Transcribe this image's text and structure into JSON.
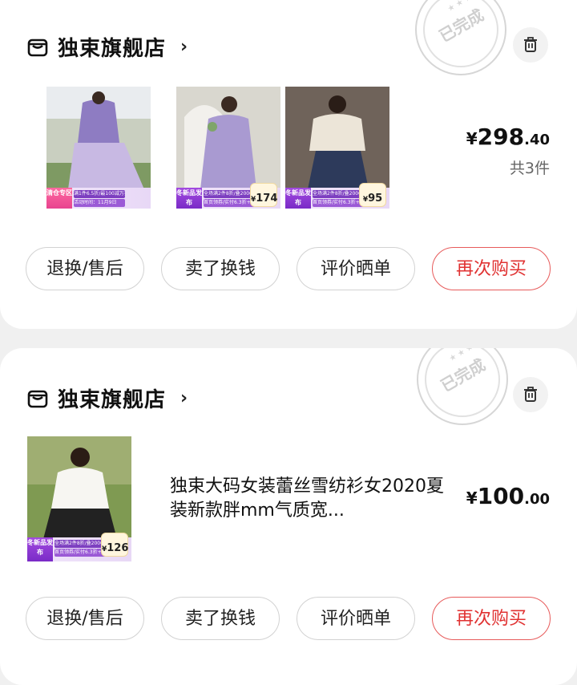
{
  "orders": [
    {
      "store_name": "独束旗舰店",
      "status_stamp": "已完成",
      "items": [
        {
          "tag": "清仓专区",
          "promo_line1": "满1件6.5折/最100减万券",
          "promo_line2": "活动时间：11月9日",
          "price": ""
        },
        {
          "tag": "冬新品发布",
          "promo_line1": "全场满2件8折/叠2000优惠券",
          "promo_line2": "首页领券/实付6.3折+",
          "price": "174"
        },
        {
          "tag": "冬新品发布",
          "promo_line1": "全场满2件8折/叠2000优惠券",
          "promo_line2": "首页领券/实付6.3折+",
          "price": "95"
        }
      ],
      "total": {
        "currency": "¥",
        "integer": "298",
        "decimal": ".40"
      },
      "count_text": "共3件",
      "buttons": [
        "退换/售后",
        "卖了换钱",
        "评价晒单",
        "再次购买"
      ]
    },
    {
      "store_name": "独束旗舰店",
      "status_stamp": "已完成",
      "items": [
        {
          "tag": "冬新品发布",
          "promo_line1": "全场满2件8折/叠2000优惠券",
          "promo_line2": "首页领券/实付6.3折+",
          "price": "126"
        }
      ],
      "item_title": "独束大码女装蕾丝雪纺衫女2020夏装新款胖mm气质宽...",
      "total": {
        "currency": "¥",
        "integer": "100",
        "decimal": ".00"
      },
      "buttons": [
        "退换/售后",
        "卖了换钱",
        "评价晒单",
        "再次购买"
      ]
    }
  ],
  "colors": {
    "accent_red": "#e03131",
    "promo_purple": "#7d3fc0"
  },
  "icons": {
    "store": "store-icon",
    "trash": "trash-icon",
    "chevron": "chevron-right-icon"
  }
}
